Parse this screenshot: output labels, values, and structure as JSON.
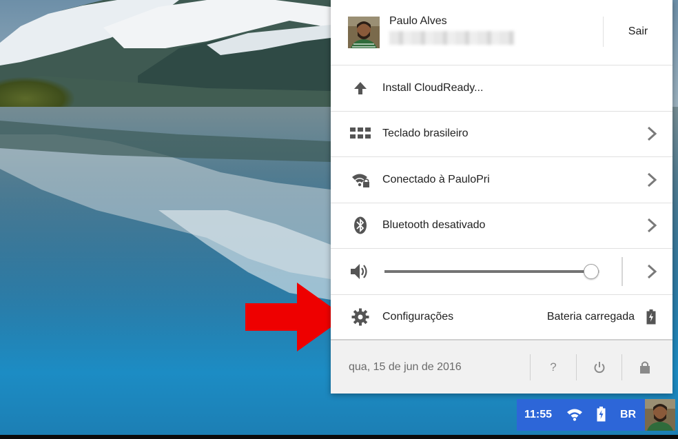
{
  "user": {
    "name": "Paulo Alves",
    "signout_label": "Sair"
  },
  "menu": {
    "install": {
      "label": "Install CloudReady...",
      "icon": "upload-arrow-icon"
    },
    "keyboard": {
      "label": "Teclado brasileiro",
      "icon": "keyboard-icon"
    },
    "network": {
      "label": "Conectado à PauloPri",
      "icon": "wifi-lock-icon"
    },
    "bluetooth": {
      "label": "Bluetooth desativado",
      "icon": "bluetooth-icon"
    },
    "volume": {
      "icon": "speaker-icon",
      "level": 0.96
    },
    "settings": {
      "label": "Configurações",
      "icon": "gear-icon",
      "battery_label": "Bateria carregada"
    }
  },
  "footer": {
    "date": "qua, 15 de jun de 2016",
    "help_label": "?",
    "help_icon": "help-icon",
    "power_icon": "power-icon",
    "lock_icon": "lock-icon"
  },
  "shelf": {
    "time": "11:55",
    "language": "BR",
    "accent": "#2d66d8"
  },
  "colors": {
    "annotation_arrow": "#ee0000"
  }
}
